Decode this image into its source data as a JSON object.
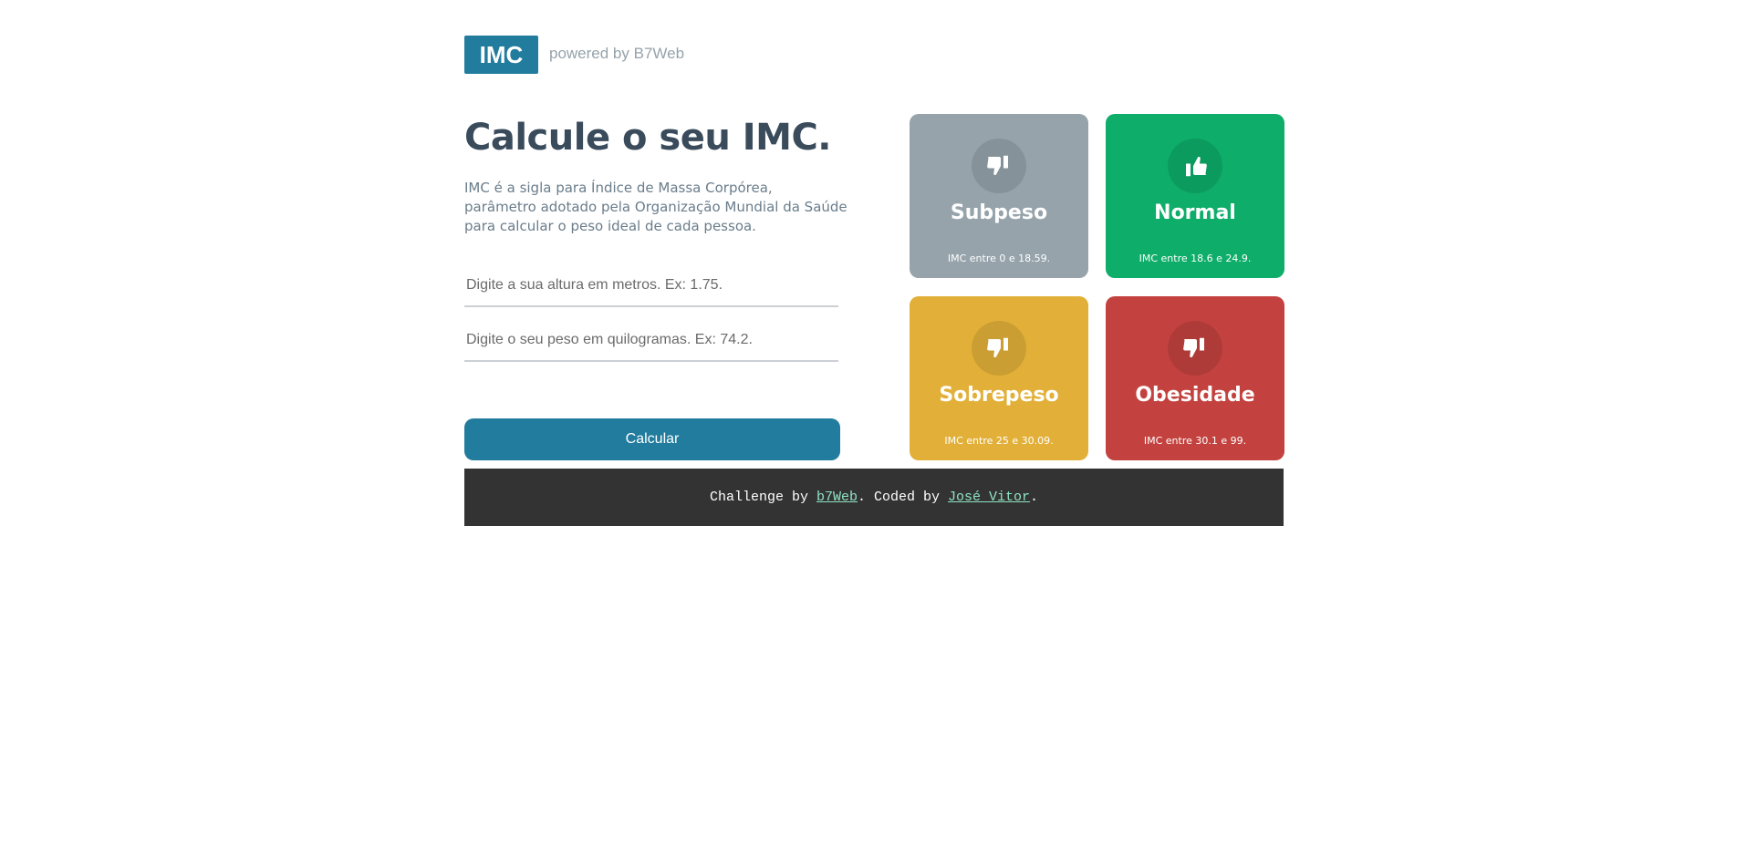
{
  "header": {
    "logo": "IMC",
    "powered": "powered by B7Web"
  },
  "main": {
    "title": "Calcule o seu IMC.",
    "description": "IMC é a sigla para Índice de Massa Corpórea, parâmetro adotado pela Organização Mundial da Saúde para calcular o peso ideal de cada pessoa.",
    "height_placeholder": "Digite a sua altura em metros. Ex: 1.75.",
    "weight_placeholder": "Digite o seu peso em quilogramas. Ex: 74.2.",
    "calculate_label": "Calcular"
  },
  "cards": [
    {
      "title": "Subpeso",
      "range": "IMC entre 0 e 18.59.",
      "color": "#96a3ab",
      "icon": "thumbs-down"
    },
    {
      "title": "Normal",
      "range": "IMC entre 18.6 e 24.9.",
      "color": "#0ead69",
      "icon": "thumbs-up"
    },
    {
      "title": "Sobrepeso",
      "range": "IMC entre 25 e 30.09.",
      "color": "#e2b039",
      "icon": "thumbs-down"
    },
    {
      "title": "Obesidade",
      "range": "IMC entre 30.1 e 99.",
      "color": "#c3423f",
      "icon": "thumbs-down"
    }
  ],
  "footer": {
    "prefix": "Challenge by ",
    "link1": "b7Web",
    "middle": ". Coded by ",
    "link2": "José Vitor",
    "suffix": "."
  }
}
